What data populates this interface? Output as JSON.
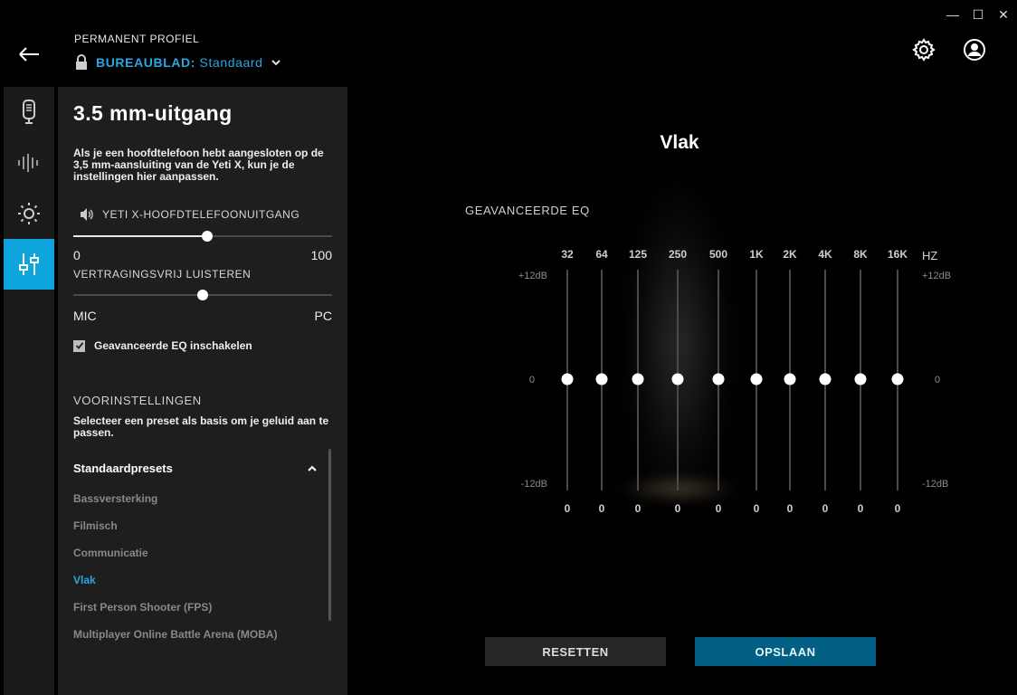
{
  "header": {
    "profile_label": "PERMANENT PROFIEL",
    "profile_prefix": "BUREAUBLAD:",
    "profile_value": "Standaard"
  },
  "window_controls": {
    "minimize": "—",
    "maximize": "☐",
    "close": "✕"
  },
  "panel": {
    "title": "3.5 mm-uitgang",
    "description": "Als je een hoofdtelefoon hebt aangesloten op de 3,5 mm-aansluiting van de Yeti X, kun je de instellingen hier aanpassen.",
    "headphone_label": "YETI X-HOOFDTELEFOONUITGANG",
    "volume": {
      "min_label": "0",
      "max_label": "100",
      "value_fraction": 0.518
    },
    "monitor_label": "VERTRAGINGSVRIJ LUISTEREN",
    "monitor": {
      "min_label": "MIC",
      "max_label": "PC",
      "value_fraction": 0.5
    },
    "advanced_eq_checkbox": "Geavanceerde EQ inschakelen",
    "advanced_eq_checked": true,
    "presets_title": "VOORINSTELLINGEN",
    "presets_description": "Selecteer een preset als basis om je geluid aan te passen.",
    "preset_group": "Standaardpresets",
    "presets": [
      "Bassversterking",
      "Filmisch",
      "Communicatie",
      "Vlak",
      "First Person Shooter (FPS)",
      "Multiplayer Online Battle Arena (MOBA)"
    ],
    "active_preset": "Vlak"
  },
  "eq": {
    "title": "Vlak",
    "subtitle": "GEAVANCEERDE EQ",
    "bands": [
      "32",
      "64",
      "125",
      "250",
      "500",
      "1K",
      "2K",
      "4K",
      "8K",
      "16K"
    ],
    "unit": "HZ",
    "db_top": "+12dB",
    "db_mid": "0",
    "db_bottom": "-12dB",
    "range": [
      -12,
      12
    ],
    "values": [
      0,
      0,
      0,
      0,
      0,
      0,
      0,
      0,
      0,
      0
    ]
  },
  "buttons": {
    "reset": "RESETTEN",
    "save": "OPSLAAN"
  },
  "colors": {
    "accent": "#2aa7e1",
    "rail_active": "#0ea5dc",
    "save_bg": "#005f82"
  }
}
